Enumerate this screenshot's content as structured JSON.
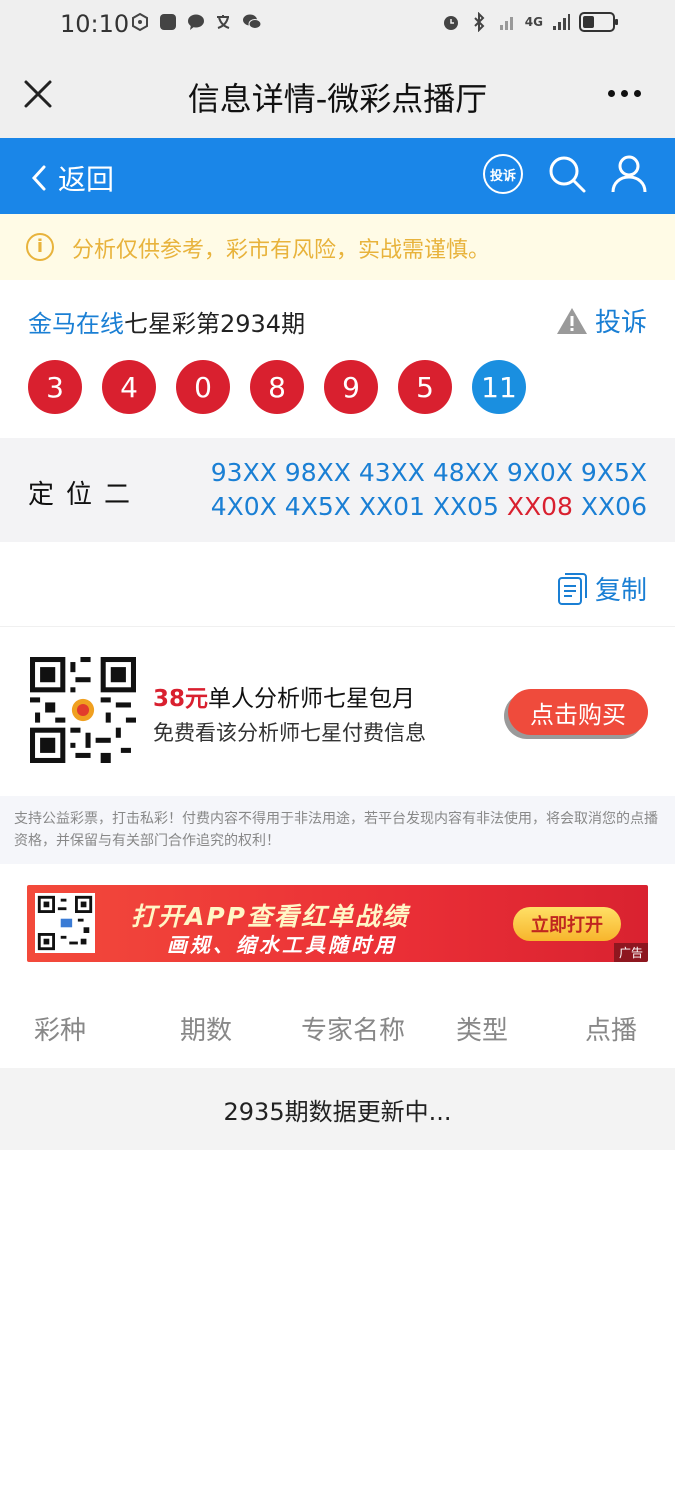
{
  "status_bar": {
    "time": "10:10",
    "signal_label": "4G"
  },
  "window": {
    "title": "信息详情-微彩点播厅"
  },
  "nav": {
    "back_label": "返回",
    "complain_badge": "投诉"
  },
  "notice": {
    "text": "分析仅供参考，彩市有风险，实战需谨慎。"
  },
  "draw": {
    "site": "金马在线",
    "issue": "七星彩第2934期",
    "report_label": "投诉",
    "balls": [
      {
        "value": "3",
        "color": "red"
      },
      {
        "value": "4",
        "color": "red"
      },
      {
        "value": "0",
        "color": "red"
      },
      {
        "value": "8",
        "color": "red"
      },
      {
        "value": "9",
        "color": "red"
      },
      {
        "value": "5",
        "color": "red"
      },
      {
        "value": "11",
        "color": "blue"
      }
    ]
  },
  "prediction": {
    "label": "定位二",
    "line1": [
      "93XX",
      "98XX",
      "43XX",
      "48XX",
      "9X0X",
      "9X5X"
    ],
    "line2": [
      "4X0X",
      "4X5X",
      "XX01",
      "XX05",
      "XX08",
      "XX06"
    ],
    "hit_index_line2": 4
  },
  "copy_label": "复制",
  "promo": {
    "price": "38元",
    "title": "单人分析师七星包月",
    "subtitle": "免费看该分析师七星付费信息",
    "buy_label": "点击购买"
  },
  "disclaimer": "支持公益彩票，打击私彩！付费内容不得用于非法用途，若平台发现内容有非法使用，将会取消您的点播资格，并保留与有关部门合作追究的权利！",
  "banner": {
    "line1": "打开APP查看红单战绩",
    "line2": "画规、缩水工具随时用",
    "open_label": "立即打开",
    "ad_label": "广告"
  },
  "table": {
    "headers": [
      "彩种",
      "期数",
      "专家名称",
      "类型",
      "点播"
    ]
  },
  "updating": "2935期数据更新中...",
  "colors": {
    "brand_blue": "#1a86e8",
    "ball_red": "#d9202f",
    "ball_blue": "#1a8fe0",
    "notice_yellow": "#e8b33c"
  }
}
